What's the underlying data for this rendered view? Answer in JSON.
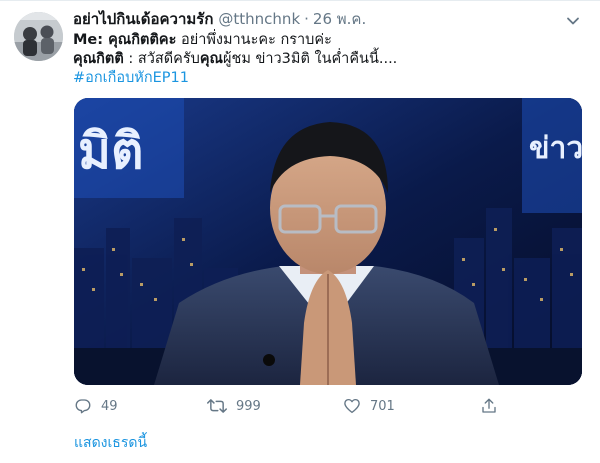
{
  "tweet": {
    "display_name": "อย่าไปกินเด้อความรัก",
    "handle": "@tthnchnk",
    "separator": "·",
    "timestamp": "26 พ.ค.",
    "lines": [
      {
        "bold": "Me: คุณกิตติคะ",
        "rest": " อย่าพึ่งมานะคะ กราบค่ะ"
      },
      {
        "bold": "คุณกิตติ",
        "rest": " : สวัสดีครับ",
        "bold2": "คุณ",
        "rest2": "ผู้ชม ข่าว3มิติ ในค่ำคืนนี้...."
      }
    ],
    "hashtag": "#อกเกือบหักEP11",
    "media": {
      "left_logo_text": "มิติ",
      "right_logo_text": "ข่าว"
    },
    "actions": {
      "reply_count": "49",
      "retweet_count": "999",
      "like_count": "701"
    },
    "show_thread": "แสดงเธรดนี้"
  },
  "icons": {
    "caret": "chevron-down-icon",
    "reply": "reply-icon",
    "retweet": "retweet-icon",
    "like": "heart-icon",
    "share": "share-icon"
  },
  "colors": {
    "text_primary": "#14171a",
    "text_secondary": "#657786",
    "link": "#1b95e0",
    "border": "#e6ecf0"
  }
}
